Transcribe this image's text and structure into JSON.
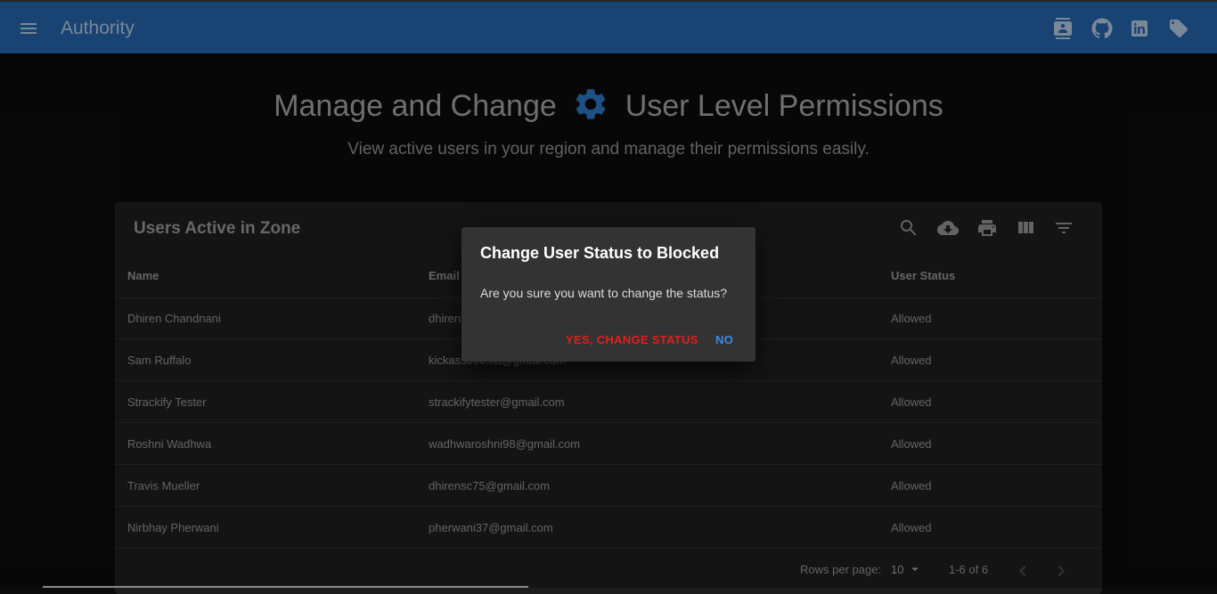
{
  "app": {
    "title": "Authority"
  },
  "header": {
    "title_part1": "Manage and Change",
    "title_part2": "User Level Permissions",
    "subtitle": "View active users in your region and manage their permissions easily."
  },
  "table": {
    "title": "Users Active in Zone",
    "columns": {
      "name": "Name",
      "email": "Email",
      "status": "User Status"
    },
    "rows": [
      {
        "name": "Dhiren Chandnani",
        "email": "dhirensc",
        "status": "Allowed"
      },
      {
        "name": "Sam Ruffalo",
        "email": "kickass090.ka@gmail.com",
        "status": "Allowed"
      },
      {
        "name": "Strackify Tester",
        "email": "strackifytester@gmail.com",
        "status": "Allowed"
      },
      {
        "name": "Roshni Wadhwa",
        "email": "wadhwaroshni98@gmail.com",
        "status": "Allowed"
      },
      {
        "name": "Travis Mueller",
        "email": "dhirensc75@gmail.com",
        "status": "Allowed"
      },
      {
        "name": "Nirbhay Pherwani",
        "email": "pherwani37@gmail.com",
        "status": "Allowed"
      }
    ],
    "footer": {
      "rows_per_page_label": "Rows per page:",
      "rows_per_page": "10",
      "range": "1-6 of 6"
    }
  },
  "dialog": {
    "title": "Change User Status to Blocked",
    "message": "Are you sure you want to change the status?",
    "confirm_label": "Yes, Change Status",
    "cancel_label": "No"
  },
  "icons": {
    "appbar": [
      "menu-icon",
      "contacts-icon",
      "github-icon",
      "linkedin-icon",
      "tag-icon"
    ],
    "toolbar": [
      "search-icon",
      "cloud-download-icon",
      "print-icon",
      "view-column-icon",
      "filter-list-icon"
    ]
  },
  "colors": {
    "appbar": "#235e9f",
    "gear": "#2a6fb6",
    "confirm": "#e0201b",
    "cancel": "#3d8ae6",
    "background": "#0b0b0b",
    "card": "#1d1d1d",
    "dialog": "#333333"
  }
}
